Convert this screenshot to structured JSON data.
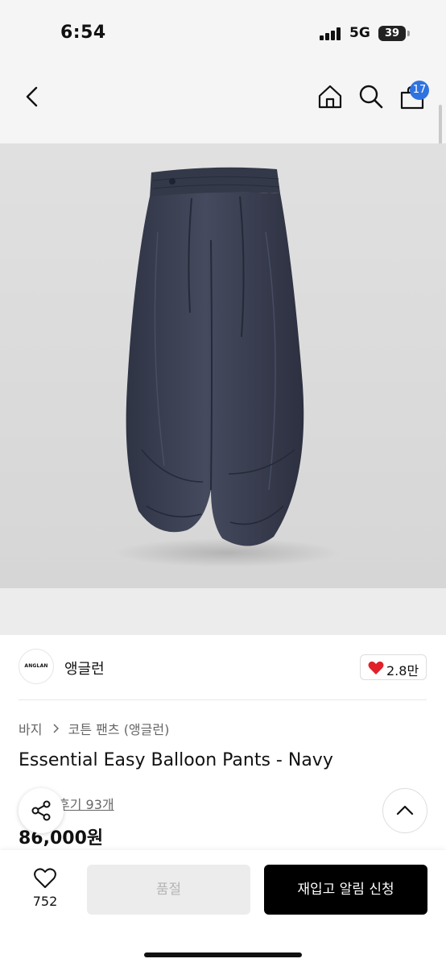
{
  "status_bar": {
    "time": "6:54",
    "network": "5G",
    "battery": "39"
  },
  "header": {
    "back_icon": "chevron-left-icon",
    "home_icon": "home-icon",
    "search_icon": "search-icon",
    "cart_icon": "shopping-bag-icon",
    "cart_count": "17",
    "badge_color": "#2f73e0"
  },
  "product_image": {
    "subject": "navy balloon pants",
    "pants_color": "#3a3f52"
  },
  "brand": {
    "logo_text": "ANGLAN",
    "name": "앵글런",
    "like_count": "2.8만",
    "heart_color": "#e0202a"
  },
  "breadcrumb": {
    "category": "바지",
    "subcategory": "코튼 팬츠 (앵글런)"
  },
  "product": {
    "title": "Essential Easy Balloon Pants - Navy",
    "reviews": "후기 93개",
    "price": "86,000원"
  },
  "floating": {
    "share_icon": "share-icon",
    "top_icon": "chevron-up-icon"
  },
  "bottom_bar": {
    "wish_icon": "heart-outline-icon",
    "wish_count": "752",
    "soldout_label": "품절",
    "restock_label": "재입고 알림 신청"
  }
}
